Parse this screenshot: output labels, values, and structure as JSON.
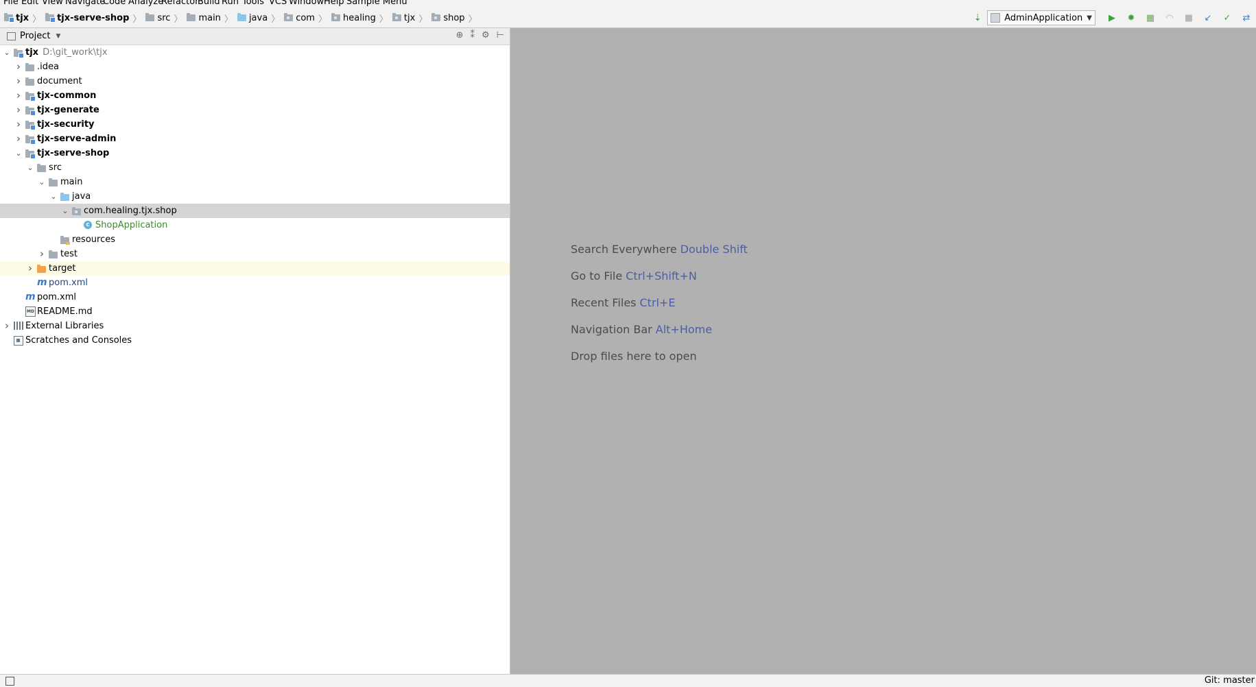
{
  "menu": [
    "File",
    "Edit",
    "View",
    "Navigate",
    "Code",
    "Analyze",
    "Refactor",
    "Build",
    "Run",
    "Tools",
    "VCS",
    "Window",
    "Help",
    "Sample Menu"
  ],
  "breadcrumbs": [
    {
      "label": "tjx",
      "bold": true,
      "icon": "module-icon"
    },
    {
      "label": "tjx-serve-shop",
      "bold": true,
      "icon": "module-folder-icon"
    },
    {
      "label": "src",
      "icon": "folder-icon"
    },
    {
      "label": "main",
      "icon": "folder-icon"
    },
    {
      "label": "java",
      "icon": "source-folder-icon"
    },
    {
      "label": "com",
      "icon": "package-icon"
    },
    {
      "label": "healing",
      "icon": "package-icon"
    },
    {
      "label": "tjx",
      "icon": "package-icon"
    },
    {
      "label": "shop",
      "icon": "package-icon"
    }
  ],
  "toolbar": {
    "run_config": "AdminApplication",
    "icons": [
      "build-icon",
      "run-icon",
      "debug-icon",
      "coverage-icon",
      "profile-icon",
      "stop-icon",
      "vcs-update-icon",
      "vcs-commit-icon",
      "vcs-history-icon"
    ]
  },
  "project_panel": {
    "title": "Project",
    "header_icons": [
      "locate-icon",
      "collapse-icon",
      "settings-icon",
      "hide-icon"
    ],
    "tree": [
      {
        "label": "tjx",
        "path": "D:\\git_work\\tjx",
        "depth": 0,
        "expanded": true,
        "bold": true,
        "icon": "module"
      },
      {
        "label": ".idea",
        "depth": 1,
        "expanded": false,
        "icon": "folder"
      },
      {
        "label": "document",
        "depth": 1,
        "expanded": false,
        "icon": "folder"
      },
      {
        "label": "tjx-common",
        "depth": 1,
        "expanded": false,
        "bold": true,
        "icon": "module"
      },
      {
        "label": "tjx-generate",
        "depth": 1,
        "expanded": false,
        "bold": true,
        "icon": "module"
      },
      {
        "label": "tjx-security",
        "depth": 1,
        "expanded": false,
        "bold": true,
        "icon": "module"
      },
      {
        "label": "tjx-serve-admin",
        "depth": 1,
        "expanded": false,
        "bold": true,
        "icon": "module"
      },
      {
        "label": "tjx-serve-shop",
        "depth": 1,
        "expanded": true,
        "bold": true,
        "icon": "module"
      },
      {
        "label": "src",
        "depth": 2,
        "expanded": true,
        "icon": "folder"
      },
      {
        "label": "main",
        "depth": 3,
        "expanded": true,
        "icon": "folder"
      },
      {
        "label": "java",
        "depth": 4,
        "expanded": true,
        "icon": "source"
      },
      {
        "label": "com.healing.tjx.shop",
        "depth": 5,
        "expanded": true,
        "icon": "package",
        "selected": true
      },
      {
        "label": "ShopApplication",
        "depth": 6,
        "icon": "class",
        "color": "green"
      },
      {
        "label": "resources",
        "depth": 4,
        "icon": "resources"
      },
      {
        "label": "test",
        "depth": 3,
        "expanded": false,
        "icon": "folder"
      },
      {
        "label": "target",
        "depth": 2,
        "expanded": false,
        "icon": "excluded",
        "excluded": true
      },
      {
        "label": "pom.xml",
        "depth": 2,
        "icon": "maven",
        "color": "blue"
      },
      {
        "label": "pom.xml",
        "depth": 1,
        "icon": "maven"
      },
      {
        "label": "README.md",
        "depth": 1,
        "icon": "markdown"
      },
      {
        "label": "External Libraries",
        "depth": 0,
        "expanded": false,
        "icon": "libraries"
      },
      {
        "label": "Scratches and Consoles",
        "depth": 0,
        "icon": "scratches"
      }
    ]
  },
  "editor": {
    "hints": [
      {
        "text": "Search Everywhere",
        "key": "Double Shift"
      },
      {
        "text": "Go to File",
        "key": "Ctrl+Shift+N"
      },
      {
        "text": "Recent Files",
        "key": "Ctrl+E"
      },
      {
        "text": "Navigation Bar",
        "key": "Alt+Home"
      },
      {
        "text": "Drop files here to open",
        "key": ""
      }
    ]
  },
  "status": {
    "git": "Git: master"
  }
}
